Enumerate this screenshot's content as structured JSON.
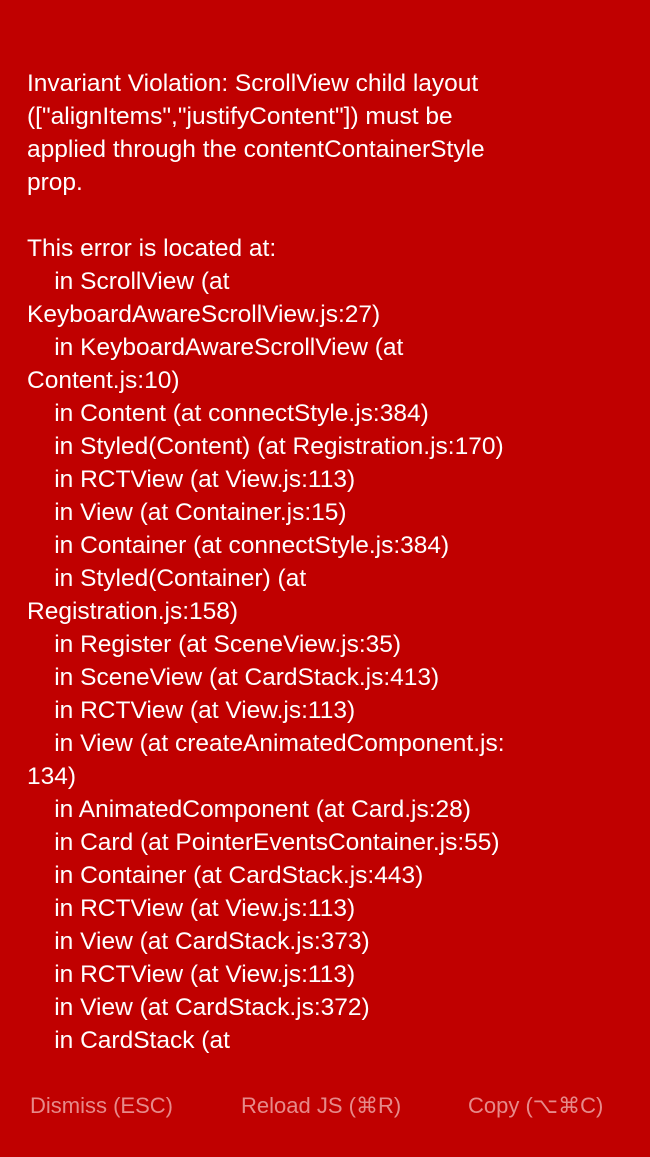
{
  "error": {
    "message_lines": [
      "Invariant Violation: ScrollView child layout",
      "([\"alignItems\",\"justifyContent\"]) must be",
      "applied through the contentContainerStyle",
      "prop.",
      "",
      "This error is located at:",
      "    in ScrollView (at",
      "KeyboardAwareScrollView.js:27)",
      "    in KeyboardAwareScrollView (at",
      "Content.js:10)",
      "    in Content (at connectStyle.js:384)",
      "    in Styled(Content) (at Registration.js:170)",
      "    in RCTView (at View.js:113)",
      "    in View (at Container.js:15)",
      "    in Container (at connectStyle.js:384)",
      "    in Styled(Container) (at",
      "Registration.js:158)",
      "    in Register (at SceneView.js:35)",
      "    in SceneView (at CardStack.js:413)",
      "    in RCTView (at View.js:113)",
      "    in View (at createAnimatedComponent.js:",
      "134)",
      "    in AnimatedComponent (at Card.js:28)",
      "    in Card (at PointerEventsContainer.js:55)",
      "    in Container (at CardStack.js:443)",
      "    in RCTView (at View.js:113)",
      "    in View (at CardStack.js:373)",
      "    in RCTView (at View.js:113)",
      "    in View (at CardStack.js:372)",
      "    in CardStack (at"
    ]
  },
  "toolbar": {
    "dismiss_label": "Dismiss (ESC)",
    "reload_label": "Reload JS (⌘R)",
    "copy_label": "Copy (⌥⌘C)"
  },
  "colors": {
    "background": "#c00000",
    "text": "#ffffff",
    "toolbar_text": "#e68a8a"
  }
}
